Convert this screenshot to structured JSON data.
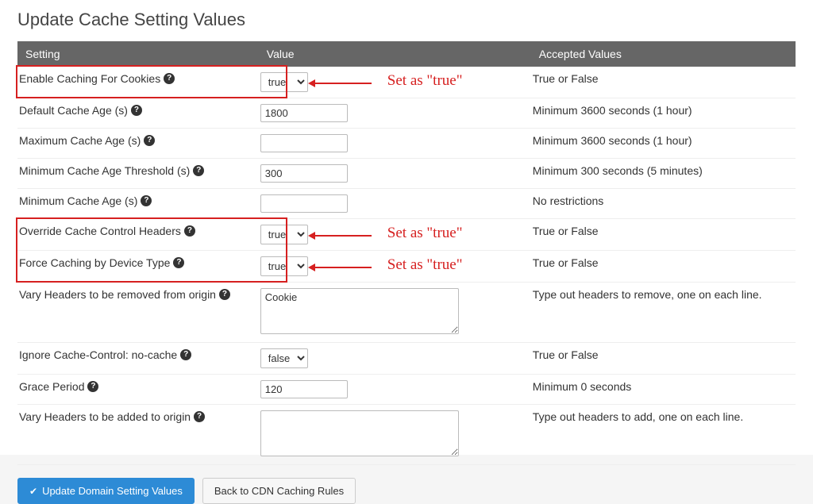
{
  "page_title": "Update Cache Setting Values",
  "headers": {
    "setting": "Setting",
    "value": "Value",
    "accepted": "Accepted Values"
  },
  "rows": [
    {
      "label": "Enable Caching For Cookies",
      "input_type": "select",
      "value": "true",
      "options": [
        "true",
        "false"
      ],
      "accepted": "True or False",
      "highlight": true,
      "annotation": "Set as \"true\""
    },
    {
      "label": "Default Cache Age (s)",
      "input_type": "text",
      "value": "1800",
      "accepted": "Minimum 3600 seconds (1 hour)"
    },
    {
      "label": "Maximum Cache Age (s)",
      "input_type": "text",
      "value": "",
      "accepted": "Minimum 3600 seconds (1 hour)"
    },
    {
      "label": "Minimum Cache Age Threshold (s)",
      "input_type": "text",
      "value": "300",
      "accepted": "Minimum 300 seconds (5 minutes)"
    },
    {
      "label": "Minimum Cache Age (s)",
      "input_type": "text",
      "value": "",
      "accepted": "No restrictions"
    },
    {
      "label": "Override Cache Control Headers",
      "input_type": "select",
      "value": "true",
      "options": [
        "true",
        "false"
      ],
      "accepted": "True or False",
      "highlight": true,
      "annotation": "Set as \"true\""
    },
    {
      "label": "Force Caching by Device Type",
      "input_type": "select",
      "value": "true",
      "options": [
        "true",
        "false"
      ],
      "accepted": "True or False",
      "highlight": true,
      "annotation": "Set as \"true\""
    },
    {
      "label": "Vary Headers to be removed from origin",
      "input_type": "textarea",
      "value": "Cookie",
      "accepted": "Type out headers to remove, one on each line."
    },
    {
      "label": "Ignore Cache-Control: no-cache",
      "input_type": "select",
      "value": "false",
      "options": [
        "true",
        "false"
      ],
      "accepted": "True or False"
    },
    {
      "label": "Grace Period",
      "input_type": "text",
      "value": "120",
      "accepted": "Minimum 0 seconds"
    },
    {
      "label": "Vary Headers to be added to origin",
      "input_type": "textarea",
      "value": "",
      "accepted": "Type out headers to add, one on each line."
    }
  ],
  "buttons": {
    "primary": "Update Domain Setting Values",
    "secondary": "Back to CDN Caching Rules"
  }
}
